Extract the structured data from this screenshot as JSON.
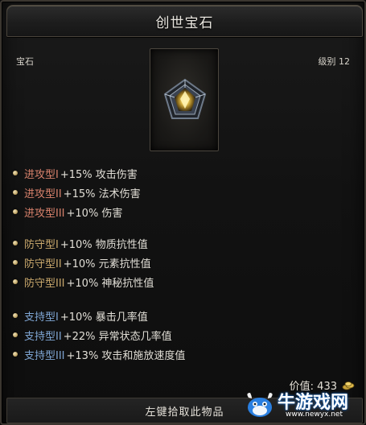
{
  "window": {
    "title": "创世宝石"
  },
  "item": {
    "type": "宝石",
    "level": "级别 12",
    "icon": "crystal-gem-icon"
  },
  "stats": {
    "attack": [
      {
        "type": "进攻型I",
        "effect": "+15% 攻击伤害"
      },
      {
        "type": "进攻型II",
        "effect": "+15% 法术伤害"
      },
      {
        "type": "进攻型III",
        "effect": "+10% 伤害"
      }
    ],
    "defense": [
      {
        "type": "防守型I",
        "effect": "+10% 物质抗性值"
      },
      {
        "type": "防守型II",
        "effect": "+10% 元素抗性值"
      },
      {
        "type": "防守型III",
        "effect": "+10% 神秘抗性值"
      }
    ],
    "support": [
      {
        "type": "支持型I",
        "effect": "+10% 暴击几率值"
      },
      {
        "type": "支持型II",
        "effect": "+22% 异常状态几率值"
      },
      {
        "type": "支持型III",
        "effect": "+13% 攻击和施放速度值"
      }
    ]
  },
  "price": {
    "label": "价值: 433",
    "icon": "gold-coins-icon"
  },
  "action": {
    "label": "左键拾取此物品"
  },
  "watermark": {
    "text": "牛游戏网",
    "url": "www.newyx.net"
  },
  "colors": {
    "attack": "#d9826c",
    "defense": "#c9a86c",
    "support": "#7fa6d4",
    "bullet": "#d8c089"
  }
}
